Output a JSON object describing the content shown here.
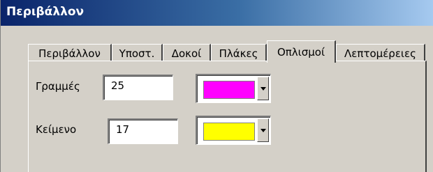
{
  "window": {
    "title": "Περιβάλλον"
  },
  "tabs": [
    {
      "label": "Περιβάλλον"
    },
    {
      "label": "Υποστ."
    },
    {
      "label": "Δοκοί"
    },
    {
      "label": "Πλάκες"
    },
    {
      "label": "Οπλισμοί",
      "active": true
    },
    {
      "label": "Λεπτομέρειες"
    }
  ],
  "fields": {
    "lines": {
      "label": "Γραμμές",
      "value": "25",
      "color": "#ff00ff"
    },
    "text": {
      "label": "Κείμενο",
      "value": "17",
      "color": "#ffff00"
    }
  },
  "colors": {
    "background": "#d4d0c8",
    "title_bar": "#0a246a"
  },
  "icons": {
    "dropdown": "chevron-down-icon"
  }
}
